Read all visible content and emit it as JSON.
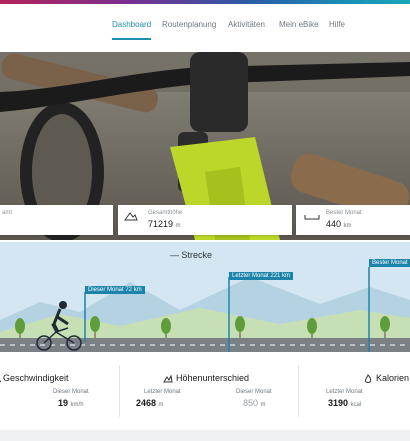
{
  "nav": {
    "items": [
      "Dashboard",
      "Routenplanung",
      "Aktivitäten",
      "Mein eBike",
      "Hilfe"
    ],
    "active": "Dashboard"
  },
  "stats": [
    {
      "label": "amt",
      "value": "",
      "unit": ""
    },
    {
      "label": "Gesamthöhe",
      "value": "71219",
      "unit": "m",
      "icon": "mountain-icon"
    },
    {
      "label": "Bester Monat",
      "value": "440",
      "unit": "km",
      "icon": "ruler-icon"
    }
  ],
  "route": {
    "title": "Strecke",
    "markers": [
      {
        "label": "Dieser Monat 72 km"
      },
      {
        "label": "Letzter Monat 221 km"
      },
      {
        "label": "Bester Monat"
      }
    ]
  },
  "sections": {
    "speed": {
      "title": "Geschwindigkeit",
      "this_month_label": "Dieser Monat",
      "this_month_value": "19",
      "unit": "km/h"
    },
    "elevation": {
      "title": "Höhenunterschied",
      "last_label": "Letzter Monat",
      "last_value": "2468",
      "last_unit": "m",
      "this_label": "Dieser Monat",
      "this_value": "850",
      "this_unit": "m"
    },
    "calories": {
      "title": "Kalorien",
      "last_label": "Letzter Monat",
      "last_value": "3190",
      "unit": "kcal"
    }
  },
  "colors": {
    "accent": "#1f8fb0",
    "bike_frame": "#bcd62a",
    "marker": "#1c84aa"
  }
}
